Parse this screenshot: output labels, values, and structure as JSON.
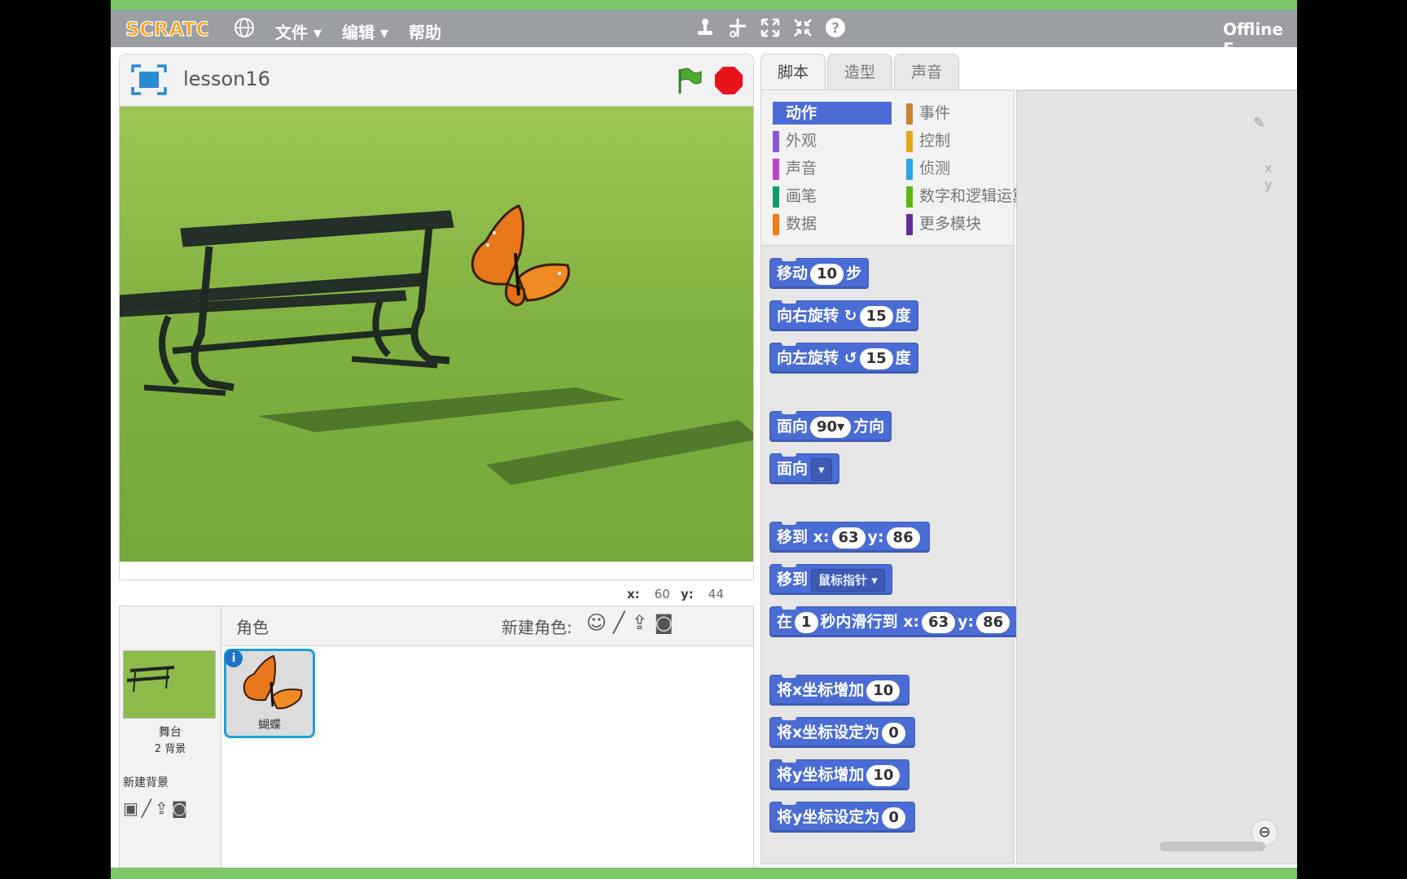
{
  "menubar": {
    "logo": "SCRATCH",
    "items": [
      "文件",
      "编辑",
      "帮助"
    ],
    "right_label": "Offline E"
  },
  "stage": {
    "project_title": "lesson16",
    "mouse_x_label": "x:",
    "mouse_x": "60",
    "mouse_y_label": "y:",
    "mouse_y": "44"
  },
  "sprites": {
    "header": "角色",
    "new_sprite_label": "新建角色:",
    "stage_label": "舞台",
    "stage_backdrops": "2 背景",
    "new_backdrop_label": "新建背景",
    "sprite_list": [
      {
        "name": "蝴蝶"
      }
    ]
  },
  "tabs": [
    "脚本",
    "造型",
    "声音"
  ],
  "categories": [
    {
      "label": "动作",
      "color": "#4a6cd4",
      "selected": true
    },
    {
      "label": "外观",
      "color": "#8a55d7"
    },
    {
      "label": "声音",
      "color": "#bb42c3"
    },
    {
      "label": "画笔",
      "color": "#0e9a6c"
    },
    {
      "label": "数据",
      "color": "#ee7d16"
    },
    {
      "label": "事件",
      "color": "#c88330"
    },
    {
      "label": "控制",
      "color": "#e1a91a"
    },
    {
      "label": "侦测",
      "color": "#2ca5e2"
    },
    {
      "label": "数字和逻辑运算",
      "color": "#5cb712"
    },
    {
      "label": "更多模块",
      "color": "#632d99"
    }
  ],
  "blocks": {
    "move": {
      "a": "移动",
      "v": "10",
      "b": "步"
    },
    "turn_right": {
      "a": "向右旋转",
      "icon": "↻",
      "v": "15",
      "b": "度"
    },
    "turn_left": {
      "a": "向左旋转",
      "icon": "↺",
      "v": "15",
      "b": "度"
    },
    "point_dir": {
      "a": "面向",
      "v": "90▾",
      "b": "方向"
    },
    "point_towards": {
      "a": "面向",
      "dd": "▾"
    },
    "goto_xy": {
      "a": "移到",
      "xl": "x:",
      "x": "63",
      "yl": "y:",
      "y": "86"
    },
    "goto": {
      "a": "移到",
      "dd": "鼠标指针 ▾"
    },
    "glide": {
      "a": "在",
      "v": "1",
      "b": "秒内滑行到",
      "xl": "x:",
      "x": "63",
      "yl": "y:",
      "y": "86"
    },
    "change_x": {
      "a": "将x坐标增加",
      "v": "10"
    },
    "set_x": {
      "a": "将x坐标设定为",
      "v": "0"
    },
    "change_y": {
      "a": "将y坐标增加",
      "v": "10"
    },
    "set_y": {
      "a": "将y坐标设定为",
      "v": "0"
    }
  },
  "scripts_area": {
    "readout_x": "x",
    "readout_y": "y"
  },
  "colors": {
    "motion": "#4a6cd4",
    "menubar": "#9b9ea2",
    "strip": "#7cc868"
  }
}
